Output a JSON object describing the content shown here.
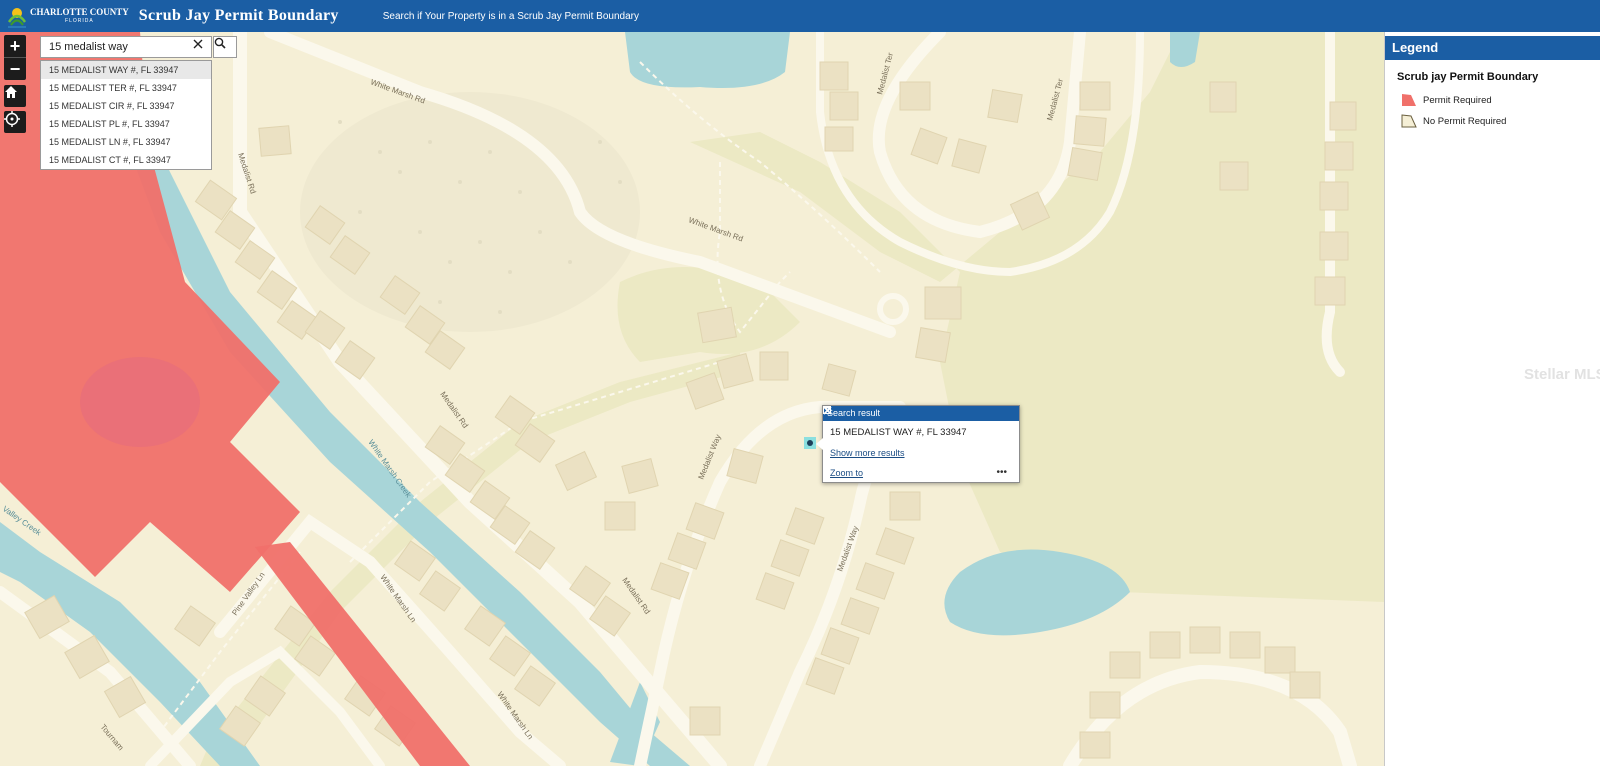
{
  "header": {
    "logo_line1": "CHARLOTTE COUNTY",
    "logo_line2": "FLORIDA",
    "title": "Scrub Jay Permit Boundary",
    "subtitle": "Search if Your Property is in a Scrub Jay Permit Boundary"
  },
  "controls": {
    "zoom_in": "+",
    "zoom_out": "−"
  },
  "search": {
    "value": "15 medalist way",
    "suggestions": [
      "15 MEDALIST WAY #, FL 33947",
      "15 MEDALIST TER #, FL 33947",
      "15 MEDALIST CIR #, FL 33947",
      "15 MEDALIST PL #, FL 33947",
      "15 MEDALIST LN #, FL 33947",
      "15 MEDALIST CT #, FL 33947"
    ]
  },
  "popup": {
    "title": "Search result",
    "result": "15 MEDALIST WAY #, FL 33947",
    "show_more": "Show more results",
    "zoom_to": "Zoom to",
    "menu": "•••"
  },
  "map_labels": {
    "white_marsh_rd_1": "White Marsh Rd",
    "white_marsh_rd_2": "White Marsh Rd",
    "medalist_rd_1": "Medalist Rd",
    "medalist_rd_2": "Medalist Rd",
    "medalist_rd_3": "Medalist Rd",
    "medalist_ter_1": "Medalist Ter",
    "medalist_ter_2": "Medalist Ter",
    "medalist_way_1": "Medalist Way",
    "medalist_way_2": "Medalist Way",
    "white_marsh_creek": "White Marsh Creek",
    "white_marsh_ln_1": "White Marsh Ln",
    "white_marsh_ln_2": "White Marsh Ln",
    "pine_valley_ln": "Pine Valley Ln",
    "pine_valley_creek": "Valley Creek",
    "tournament": "Tournam"
  },
  "legend": {
    "title": "Legend",
    "layer_title": "Scrub jay Permit Boundary",
    "items": [
      {
        "label": "Permit Required",
        "color": "#f0706a"
      },
      {
        "label": "No Permit Required",
        "color": "#f5efd6"
      }
    ]
  },
  "watermark": "Stellar MLS",
  "colors": {
    "header_bg": "#1b5ea4",
    "permit_required": "#f0706a",
    "base_land": "#f5efd6",
    "water": "#a8d5d8",
    "park": "#ece9c4",
    "building": "#ebe1c3"
  }
}
